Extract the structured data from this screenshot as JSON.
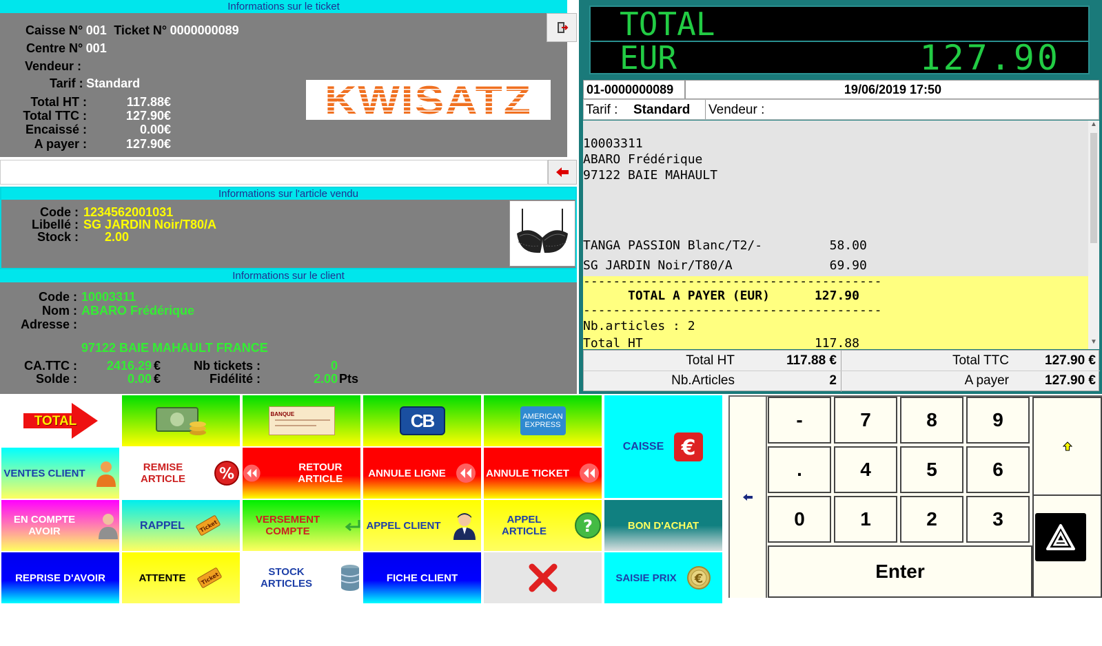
{
  "ticket_info": {
    "title": "Informations sur le ticket",
    "caisse_label": "Caisse N°",
    "caisse_value": "001",
    "ticket_label": "Ticket N°",
    "ticket_value": "0000000089",
    "centre_label": "Centre N°",
    "centre_value": "001",
    "vendeur_label": "Vendeur :",
    "vendeur_value": "",
    "tarif_label": "Tarif :",
    "tarif_value": "Standard",
    "total_ht_label": "Total HT :",
    "total_ht_value": "117.88€",
    "total_ttc_label": "Total TTC :",
    "total_ttc_value": "127.90€",
    "encaisse_label": "Encaissé :",
    "encaisse_value": "0.00€",
    "a_payer_label": "A payer :",
    "a_payer_value": "127.90€",
    "logo": "KWISATZ"
  },
  "article_info": {
    "title": "Informations sur l'article vendu",
    "code_label": "Code :",
    "code_value": "1234562001031",
    "libelle_label": "Libellé :",
    "libelle_value": "SG JARDIN Noir/T80/A",
    "stock_label": "Stock :",
    "stock_value": "2.00"
  },
  "client_info": {
    "title": "Informations sur le client",
    "code_label": "Code :",
    "code_value": "10003311",
    "nom_label": "Nom :",
    "nom_value": "ABARO Frédérique",
    "adresse_label": "Adresse :",
    "adresse_value": "97122 BAIE MAHAULT FRANCE",
    "ca_label": "CA.TTC :",
    "ca_value": "2416.29",
    "ca_unit": "€",
    "solde_label": "Solde :",
    "solde_value": "0.00",
    "solde_unit": "€",
    "nb_tickets_label": "Nb tickets :",
    "nb_tickets_value": "0",
    "fidelite_label": "Fidélité :",
    "fidelite_value": "2.00",
    "fidelite_unit": "Pts"
  },
  "display": {
    "line1": "TOTAL",
    "currency": "EUR",
    "amount": "127.90"
  },
  "receipt": {
    "ticket_id": "01-0000000089",
    "datetime": "19/06/2019 17:50",
    "tarif_label": "Tarif :",
    "tarif_value": "Standard",
    "vendeur_label": "Vendeur :",
    "client_code": "10003311",
    "client_name": "ABARO Frédérique",
    "client_city": "97122 BAIE MAHAULT",
    "item1": "TANGA PASSION Blanc/T2/-         58.00",
    "item2": "SG JARDIN Noir/T80/A             69.90",
    "separator": "----------------------------------------",
    "total_line": "      TOTAL A PAYER (EUR)      127.90",
    "nb_articles_line": "Nb.articles : 2",
    "total_ht_line": "Total HT                       117.88",
    "footer": {
      "total_ht_label": "Total HT",
      "total_ht_value": "117.88 €",
      "total_ttc_label": "Total TTC",
      "total_ttc_value": "127.90 €",
      "nb_articles_label": "Nb.Articles",
      "nb_articles_value": "2",
      "a_payer_label": "A payer",
      "a_payer_value": "127.90 €"
    }
  },
  "buttons": {
    "total": "TOTAL",
    "ventes_client": "VENTES CLIENT",
    "remise_article": "REMISE ARTICLE",
    "retour_article": "RETOUR ARTICLE",
    "annule_ligne": "ANNULE LIGNE",
    "annule_ticket": "ANNULE TICKET",
    "caisse": "CAISSE",
    "en_compte_avoir": "EN COMPTE AVOIR",
    "rappel": "RAPPEL",
    "versement_compte": "VERSEMENT COMPTE",
    "appel_client": "APPEL CLIENT",
    "appel_article": "APPEL ARTICLE",
    "bon_achat": "BON D'ACHAT",
    "reprise_avoir": "REPRISE D'AVOIR",
    "attente": "ATTENTE",
    "stock_articles": "STOCK ARTICLES",
    "fiche_client": "FICHE CLIENT",
    "saisie_prix": "SAISIE PRIX",
    "cheque_text": "BANQUE",
    "cb_text": "CB",
    "amex_text": "AMERICAN EXPRESS",
    "ticket_icon_text": "Ticket"
  },
  "keypad": {
    "minus": "-",
    "k7": "7",
    "k8": "8",
    "k9": "9",
    "dot": ".",
    "k4": "4",
    "k5": "5",
    "k6": "6",
    "k0": "0",
    "k1": "1",
    "k2": "2",
    "k3": "3",
    "enter": "Enter"
  }
}
